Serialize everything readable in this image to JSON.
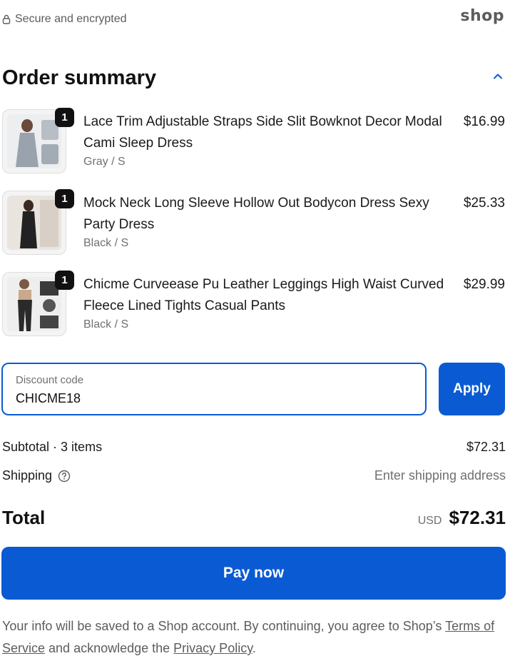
{
  "header": {
    "secure_text": "Secure and encrypted",
    "shop_logo": "shop"
  },
  "summary": {
    "title": "Order summary",
    "collapse_icon": "chevron-up-icon"
  },
  "items": [
    {
      "quantity": "1",
      "name": "Lace Trim Adjustable Straps Side Slit Bowknot Decor Modal Cami Sleep Dress",
      "variant": "Gray / S",
      "price": "$16.99",
      "thumb_color": "#9aa3ad"
    },
    {
      "quantity": "1",
      "name": "Mock Neck Long Sleeve Hollow Out Bodycon Dress Sexy Party Dress",
      "variant": "Black / S",
      "price": "$25.33",
      "thumb_color": "#222222"
    },
    {
      "quantity": "1",
      "name": "Chicme Curveease Pu Leather Leggings High Waist Curved Fleece Lined Tights Casual Pants",
      "variant": "Black / S",
      "price": "$29.99",
      "thumb_color": "#2a2a2a"
    }
  ],
  "discount": {
    "label": "Discount code",
    "value": "CHICME18",
    "apply_label": "Apply"
  },
  "totals": {
    "subtotal_label": "Subtotal · 3 items",
    "subtotal_value": "$72.31",
    "shipping_label": "Shipping",
    "shipping_value": "Enter shipping address",
    "total_label": "Total",
    "currency": "USD",
    "total_value": "$72.31"
  },
  "pay": {
    "label": "Pay now"
  },
  "legal": {
    "text_before": "Your info will be saved to a Shop account. By continuing, you agree to Shop’s ",
    "terms_link": "Terms of Service",
    "text_middle": " and acknowledge the ",
    "privacy_link": "Privacy Policy",
    "text_after": "."
  },
  "colors": {
    "accent": "#0a5bd3",
    "muted": "#707070",
    "badge": "#111111"
  }
}
